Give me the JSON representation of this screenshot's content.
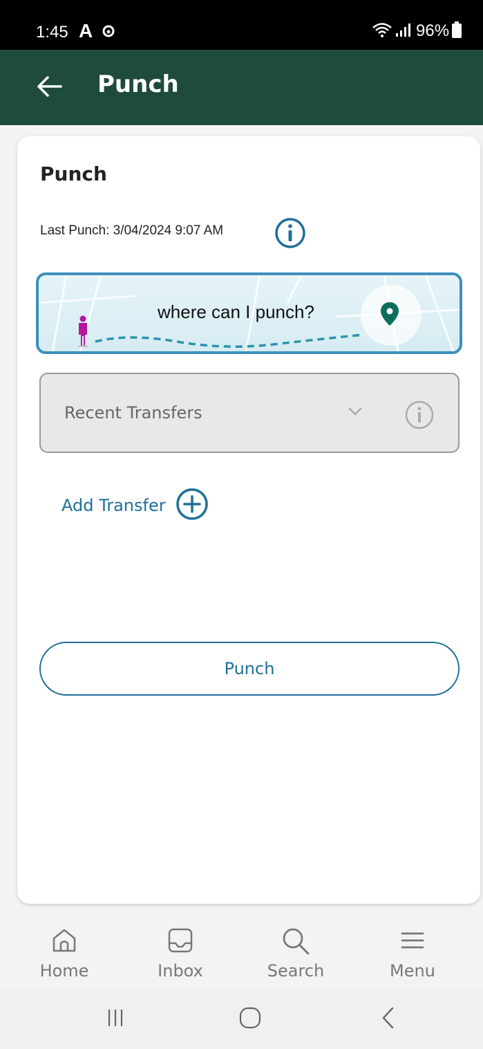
{
  "status_bar": {
    "time": "1:45",
    "carrier_glyph": "A",
    "battery_percent": "96%"
  },
  "app_bar": {
    "title": "Punch"
  },
  "card": {
    "title": "Punch",
    "last_punch": "Last Punch: 3/04/2024 9:07 AM",
    "map_banner_text": "where can I punch?",
    "dropdown_label": "Recent Transfers",
    "add_transfer_label": "Add Transfer",
    "punch_button_label": "Punch"
  },
  "bottom_nav": {
    "items": [
      {
        "label": "Home",
        "icon": "home-icon"
      },
      {
        "label": "Inbox",
        "icon": "inbox-icon"
      },
      {
        "label": "Search",
        "icon": "search-icon"
      },
      {
        "label": "Menu",
        "icon": "menu-icon"
      }
    ]
  },
  "colors": {
    "app_bar": "#1e4b3c",
    "accent_blue": "#1f6e98",
    "pin_green": "#0e6e5e",
    "person_magenta": "#b3179e"
  }
}
